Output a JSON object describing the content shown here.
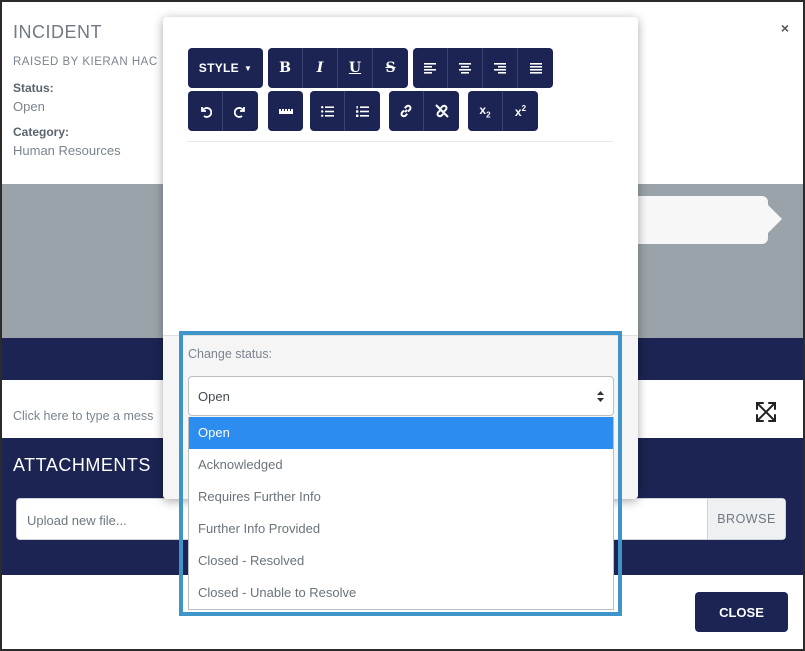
{
  "incident": {
    "title": "INCIDENT",
    "raised_by": "RAISED BY KIERAN HAC",
    "status_label": "Status:",
    "status_value": "Open",
    "category_label": "Category:",
    "category_value": "Human Resources",
    "close_x": "×"
  },
  "message": {
    "placeholder": "Click here to type a mess"
  },
  "attachments": {
    "title": "ATTACHMENTS",
    "upload_placeholder": "Upload new file...",
    "browse_label": "BROWSE"
  },
  "footer": {
    "close_label": "CLOSE"
  },
  "toolbar": {
    "style_label": "STYLE",
    "bold": "B",
    "italic": "I",
    "underline": "U",
    "strikethrough": "S"
  },
  "status_selector": {
    "label": "Change status:",
    "selected": "Open",
    "options": [
      "Open",
      "Acknowledged",
      "Requires Further Info",
      "Further Info Provided",
      "Closed - Resolved",
      "Closed - Unable to Resolve"
    ]
  },
  "colors": {
    "navy": "#1b2452",
    "highlight": "#3f95c9",
    "selected_option": "#2d8cf0"
  }
}
